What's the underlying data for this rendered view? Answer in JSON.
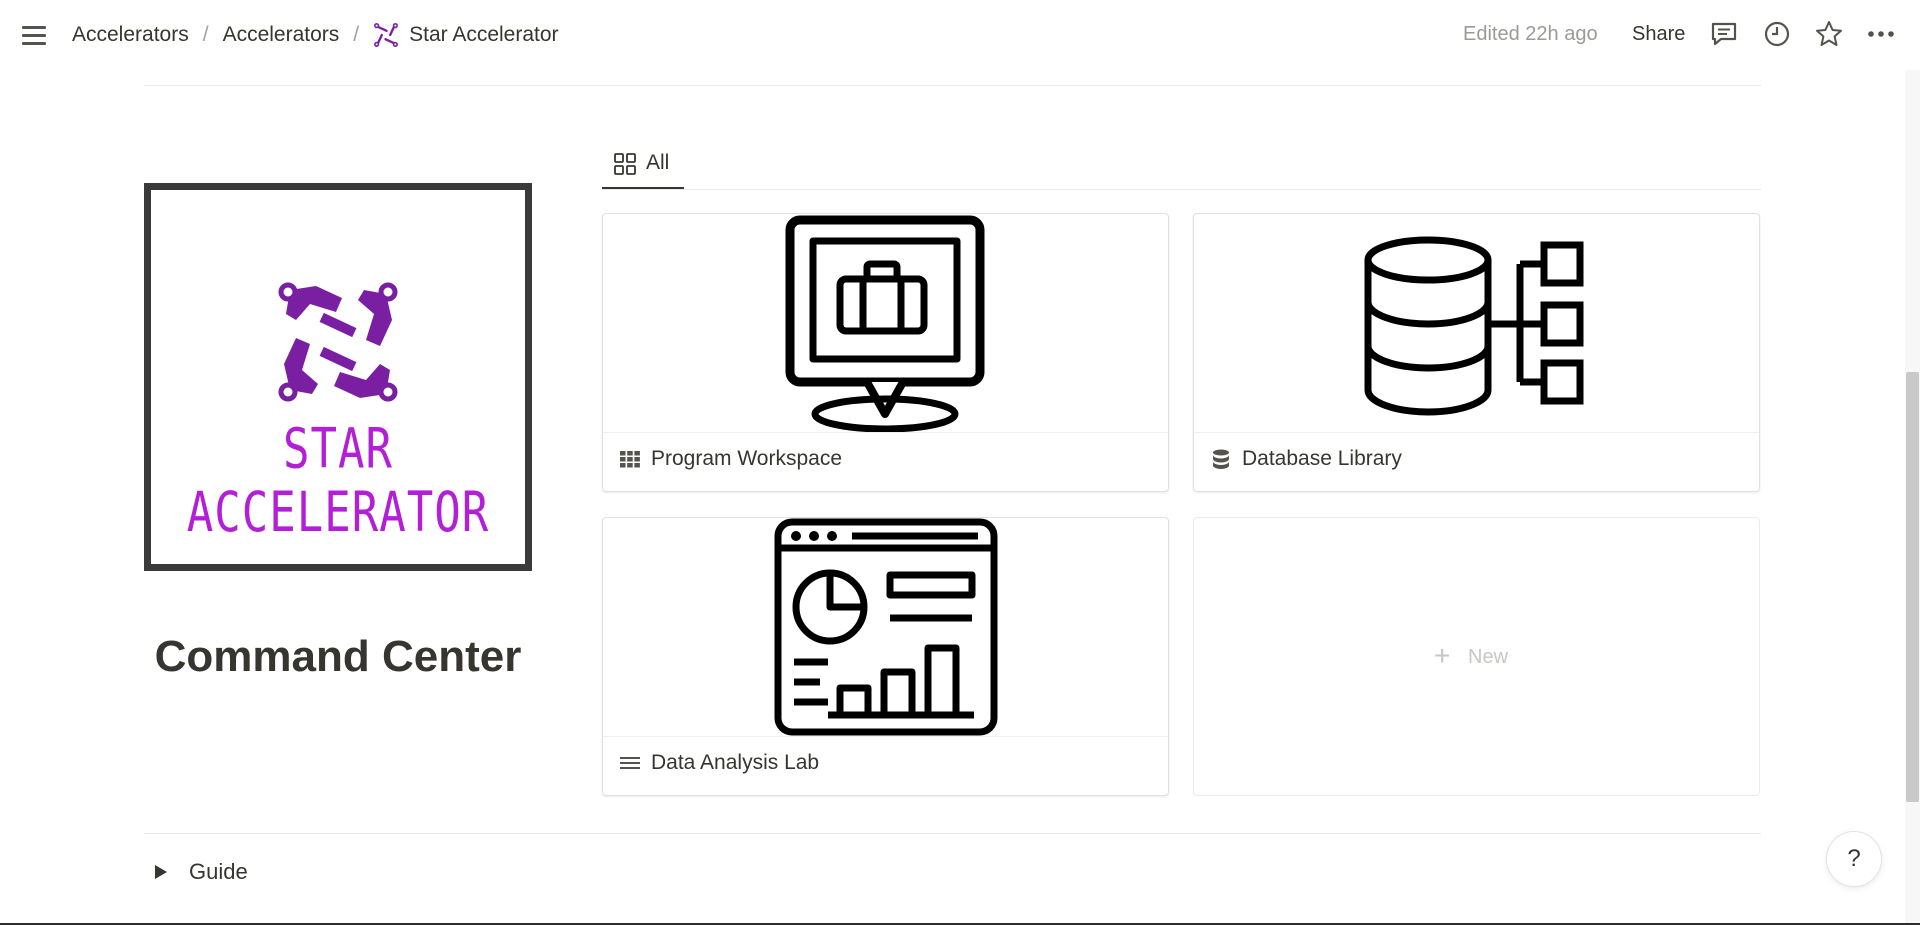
{
  "topbar": {
    "breadcrumbs": [
      "Accelerators",
      "Accelerators",
      "Star Accelerator"
    ],
    "separator": "/",
    "edited": "Edited 22h ago",
    "share": "Share",
    "icons": [
      "menu-icon",
      "comment-icon",
      "clock-icon",
      "star-icon",
      "more-icon"
    ]
  },
  "logo": {
    "text": "STAR ACCELERATOR",
    "color": "#b21fd6",
    "mark_color": "#7b1fa2"
  },
  "page": {
    "title": "Command Center"
  },
  "views": {
    "tabs": [
      {
        "label": "All",
        "icon": "gallery-icon",
        "active": true
      }
    ]
  },
  "gallery": {
    "cards": [
      {
        "title": "Program Workspace",
        "icon": "grid-icon",
        "cover_icon": "monitor-briefcase-icon"
      },
      {
        "title": "Database Library",
        "icon": "database-icon",
        "cover_icon": "database-tree-icon"
      },
      {
        "title": "Data Analysis Lab",
        "icon": "lines-icon",
        "cover_icon": "dashboard-icon"
      }
    ],
    "new_card": {
      "plus": "+",
      "label": "New"
    }
  },
  "guide": {
    "label": "Guide"
  },
  "help": {
    "label": "?"
  }
}
